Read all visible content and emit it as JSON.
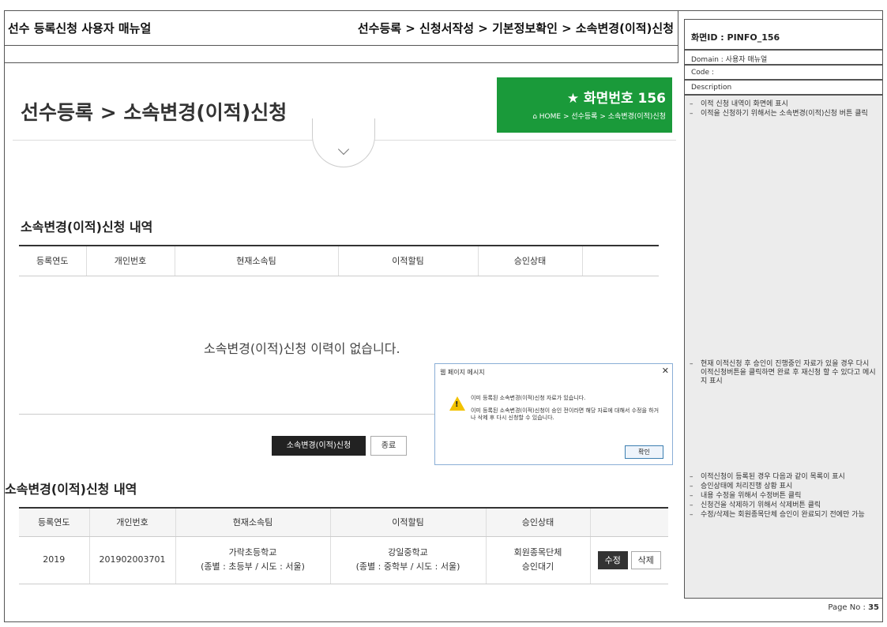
{
  "header": {
    "manual_title": "선수 등록신청 사용자 매뉴얼",
    "path": "선수등록 > 신청서작성 > 기본정보확인 > 소속변경(이적)신청"
  },
  "page": {
    "title": "선수등록 > 소속변경(이적)신청",
    "screen_no": "★  화면번호 156",
    "crumb": "HOME > 선수등록 > 소속변경(이적)신청"
  },
  "section1": {
    "title": "소속변경(이적)신청 내역",
    "columns": [
      "등록연도",
      "개인번호",
      "현재소속팀",
      "이적할팀",
      "승인상태",
      ""
    ],
    "empty_message": "소속변경(이적)신청 이력이 없습니다.",
    "apply_button": "소속변경(이적)신청",
    "close_button": "종료"
  },
  "dialog": {
    "title": "웹 페이지 메시지",
    "close": "✕",
    "message1": "이미 등록된 소속변경(이적)신청 자료가 있습니다.",
    "message2": "이미 등록된 소속변경(이적)신청이 승인 전이라면 해당 자료에 대해서 수정을 하거나 삭제 후 다시 신청할 수 있습니다.",
    "ok": "확인"
  },
  "section2": {
    "title": "소속변경(이적)신청 내역",
    "columns": [
      "등록연도",
      "개인번호",
      "현재소속팀",
      "이적할팀",
      "승인상태",
      ""
    ],
    "row": {
      "year": "2019",
      "personal_no": "201902003701",
      "current_team": "가락초등학교",
      "current_team_sub": "(종별 : 초등부 / 시도 : 서울)",
      "target_team": "강일중학교",
      "target_team_sub": "(종별 : 중학부 / 시도 : 서울)",
      "status": "회원종목단체",
      "status_sub": "승인대기",
      "edit": "수정",
      "delete": "삭제"
    }
  },
  "panel": {
    "screen_id": "화면ID : PINFO_156",
    "domain": "Domain : 사용자 매뉴얼",
    "code": "Code :",
    "description": "Description",
    "notes1": [
      "이적 신청 내역이 화면에 표시",
      "이적을 신청하기 위해서는 소속변경(이적)신청 버튼 클릭"
    ],
    "notes2": [
      "현재 이적신청 후 승인이 진행중인 자료가 있을 경우 다시 이적신청버튼을 클릭하면 완료 후 재신청 할 수 있다고 메시지 표시"
    ],
    "notes3": [
      "이적신청이 등록된 경우 다음과 같이 목록이 표시",
      "승인상태에 처리진행 상황 표시",
      "내용 수정을 위해서 수정버튼 클릭",
      "신청건을 삭제하기 위해서 삭제버튼 클릭",
      "수정/삭제는 회원종목단체 승인이 완료되기 전에만 가능"
    ]
  },
  "footer": {
    "page_label": "Page No : ",
    "page_number": "35"
  }
}
